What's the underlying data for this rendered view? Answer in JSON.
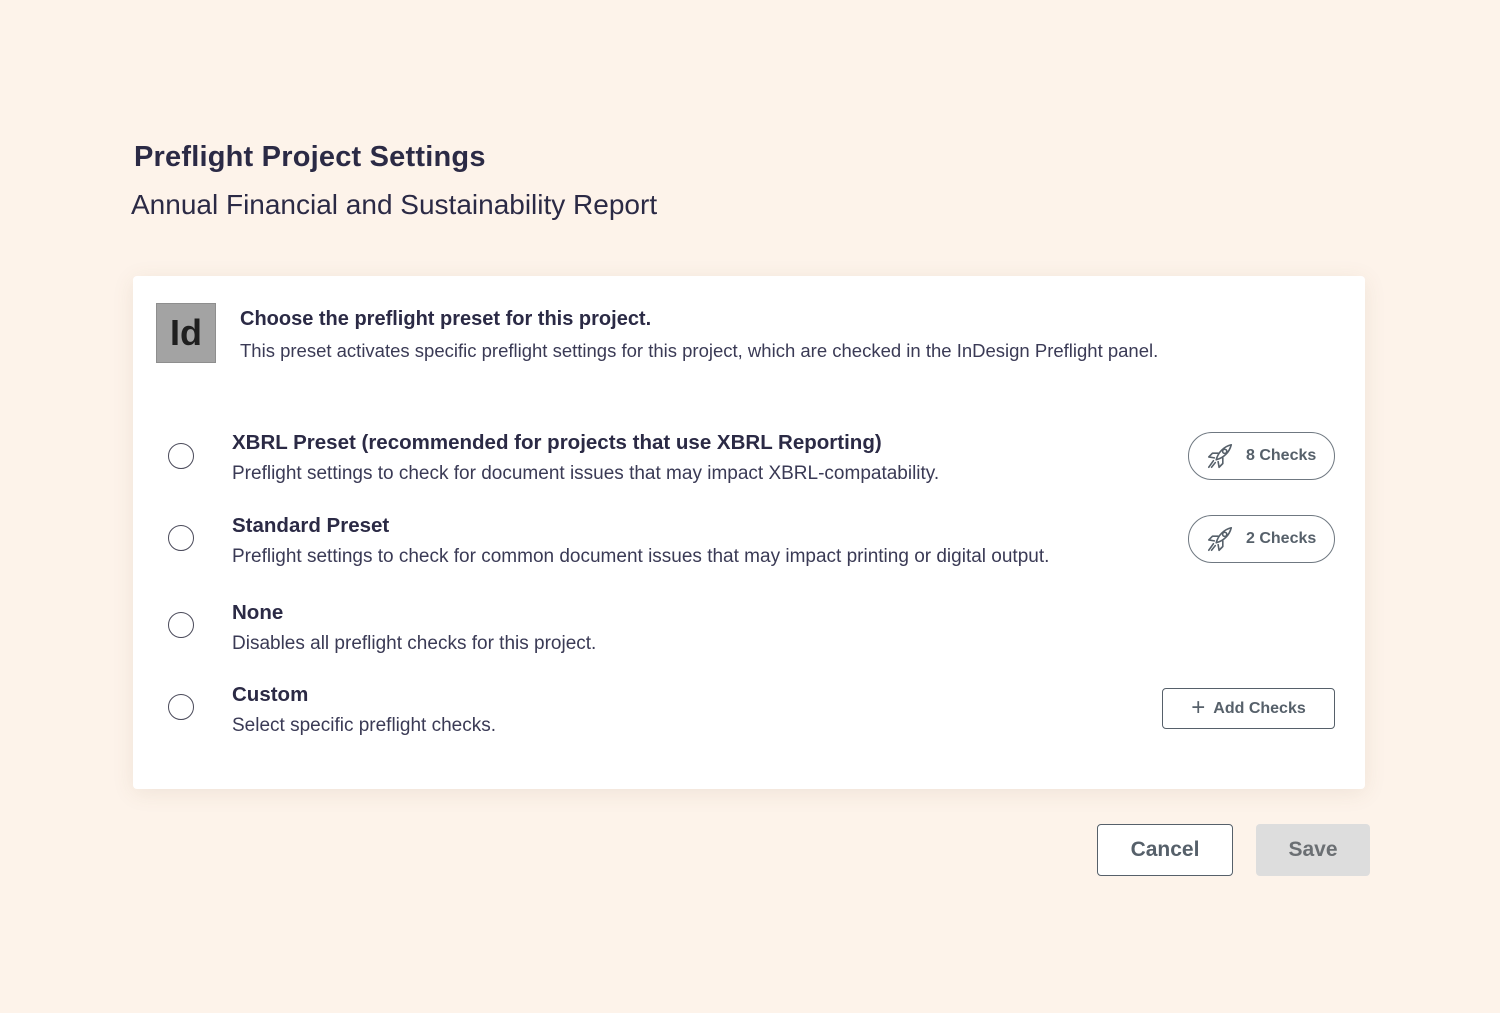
{
  "header": {
    "title": "Preflight Project Settings",
    "subtitle": "Annual Financial and Sustainability Report"
  },
  "card": {
    "app_icon_label": "Id",
    "intro_title": "Choose the preflight preset for this project.",
    "intro_description": "This preset activates specific preflight settings for this project, which are checked in the InDesign Preflight panel.",
    "options": [
      {
        "label": "XBRL Preset (recommended for projects that use XBRL Reporting)",
        "description": "Preflight settings to check for document issues that may impact XBRL-compatability.",
        "checks_label": "8 Checks",
        "selected": false
      },
      {
        "label": "Standard Preset",
        "description": "Preflight settings to check for common document issues that may impact printing or digital output.",
        "checks_label": "2 Checks",
        "selected": false
      },
      {
        "label": "None",
        "description": "Disables all preflight checks for this project.",
        "selected": false
      },
      {
        "label": "Custom",
        "description": "Select specific preflight checks.",
        "add_label": "Add Checks",
        "selected": false
      }
    ]
  },
  "footer": {
    "cancel_label": "Cancel",
    "save_label": "Save"
  },
  "icons": {
    "checks": "rocket-icon",
    "add": "plus-icon"
  },
  "colors": {
    "background": "#fdf3ea",
    "text": "#2b2a45",
    "button_border": "#56606a",
    "save_disabled": "#dddddd"
  }
}
